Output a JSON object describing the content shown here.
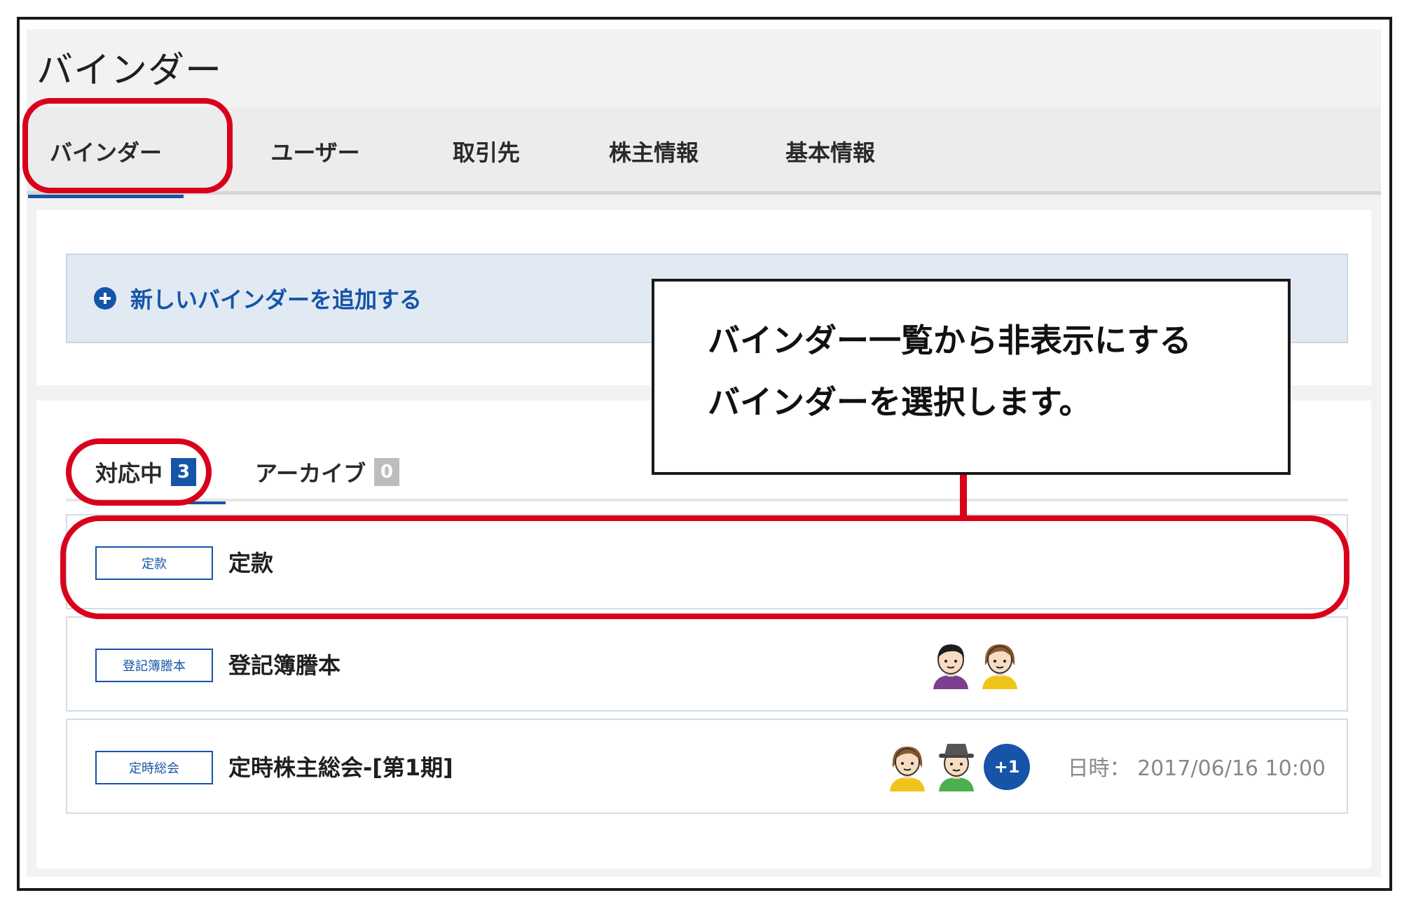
{
  "app": {
    "title": "バインダー"
  },
  "nav": {
    "tabs": [
      {
        "label": "バインダー",
        "active": true
      },
      {
        "label": "ユーザー"
      },
      {
        "label": "取引先"
      },
      {
        "label": "株主情報"
      },
      {
        "label": "基本情報"
      }
    ]
  },
  "add_binder": {
    "label": "新しいバインダーを追加する",
    "icon": "plus-circle-icon"
  },
  "sub_tabs": [
    {
      "label": "対応中",
      "count": "3",
      "active": true
    },
    {
      "label": "アーカイブ",
      "count": "0"
    }
  ],
  "binders": [
    {
      "tag": "定款",
      "title": "定款",
      "avatars": [],
      "more": "",
      "date": ""
    },
    {
      "tag": "登記簿謄本",
      "title": "登記簿謄本",
      "avatars": [
        "user-avatar-man",
        "user-avatar-woman"
      ],
      "more": "",
      "date": ""
    },
    {
      "tag": "定時総会",
      "title": "定時株主総会-[第1期]",
      "avatars": [
        "user-avatar-woman",
        "user-avatar-man-hat"
      ],
      "more": "+1",
      "date": "日時： 2017/06/16 10:00"
    }
  ],
  "callout": {
    "lines": [
      "バインダー一覧から非表示にする",
      "バインダーを選択します。"
    ]
  },
  "colors": {
    "accent": "#1654a8",
    "highlight": "#d9001b",
    "add_bar_bg": "#e1eaf3"
  }
}
